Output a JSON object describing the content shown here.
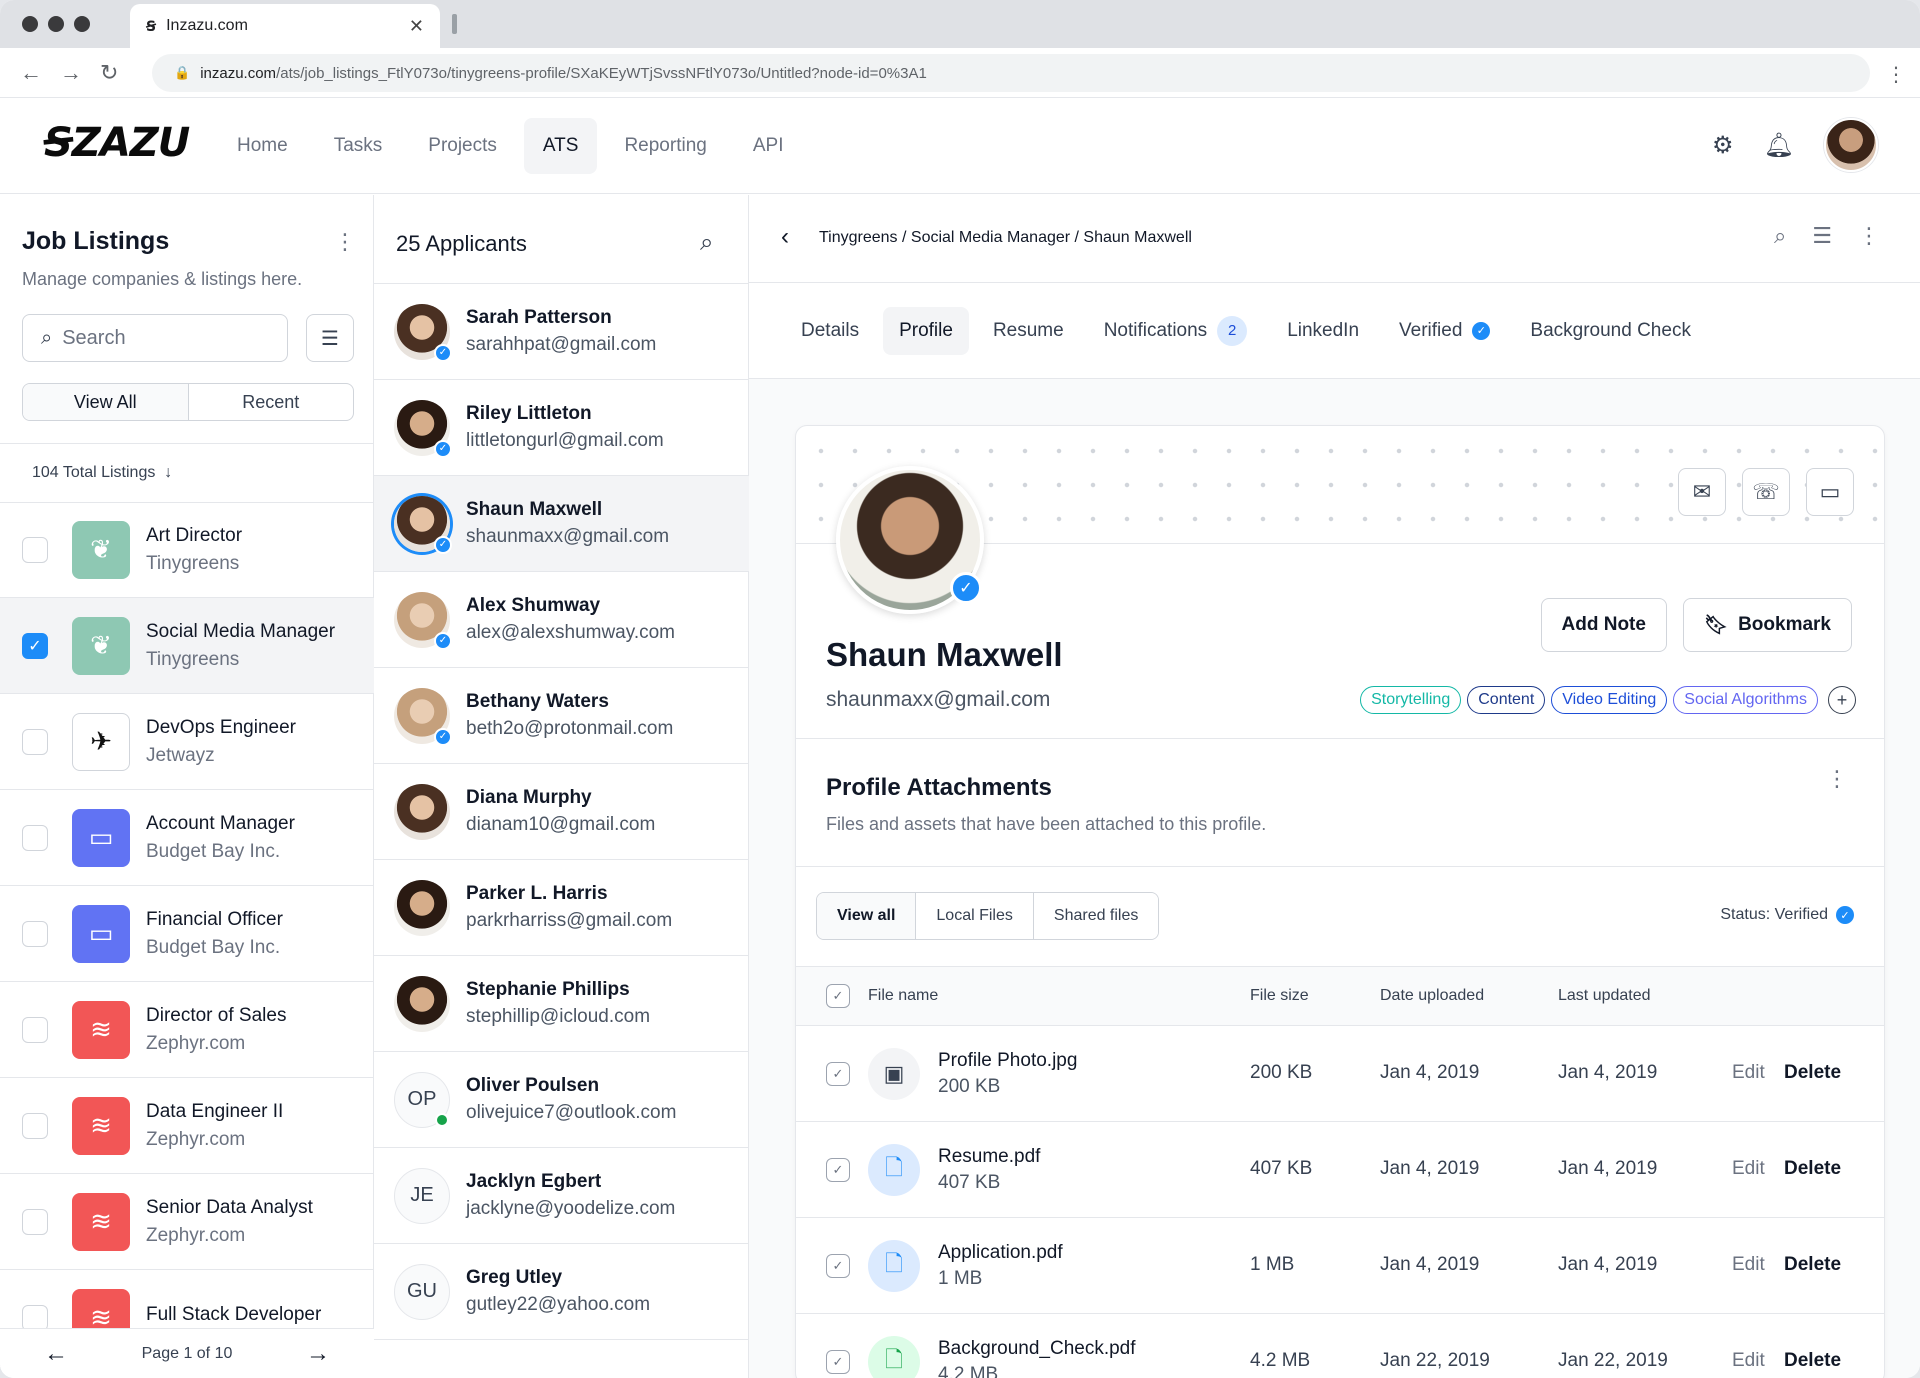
{
  "browser": {
    "tab_title": "Inzazu.com",
    "url_host": "inzazu.com",
    "url_path": "/ats/job_listings_FtlY073o/tinygreens-profile/SXaKEyWTjSvssNFtlY073o/Untitled?node-id=0%3A1"
  },
  "app": {
    "logo": "ꞨZAZU",
    "nav": [
      "Home",
      "Tasks",
      "Projects",
      "ATS",
      "Reporting",
      "API"
    ],
    "active_nav": "ATS"
  },
  "listings": {
    "title": "Job Listings",
    "subtitle": "Manage companies & listings here.",
    "search_placeholder": "Search",
    "view_all": "View All",
    "recent": "Recent",
    "total": "104 Total Listings",
    "items": [
      {
        "title": "Art Director",
        "company": "Tinygreens",
        "logo": "leaf-icon"
      },
      {
        "title": "Social Media Manager",
        "company": "Tinygreens",
        "logo": "leaf-icon",
        "selected": true
      },
      {
        "title": "DevOps Engineer",
        "company": "Jetwayz",
        "logo": "plane-icon"
      },
      {
        "title": "Account Manager",
        "company": "Budget Bay Inc.",
        "logo": "card-icon"
      },
      {
        "title": "Financial Officer",
        "company": "Budget Bay Inc.",
        "logo": "card-icon"
      },
      {
        "title": "Director of Sales",
        "company": "Zephyr.com",
        "logo": "wind-icon"
      },
      {
        "title": "Data Engineer II",
        "company": "Zephyr.com",
        "logo": "wind-icon"
      },
      {
        "title": "Senior Data Analyst",
        "company": "Zephyr.com",
        "logo": "wind-icon"
      },
      {
        "title": "Full Stack Developer",
        "company": "",
        "logo": "wind-icon"
      }
    ],
    "pager": "Page 1 of 10"
  },
  "applicants": {
    "title": "25 Applicants",
    "items": [
      {
        "name": "Sarah Patterson",
        "email": "sarahhpat@gmail.com"
      },
      {
        "name": "Riley Littleton",
        "email": "littletongurl@gmail.com"
      },
      {
        "name": "Shaun Maxwell",
        "email": "shaunmaxx@gmail.com"
      },
      {
        "name": "Alex Shumway",
        "email": "alex@alexshumway.com"
      },
      {
        "name": "Bethany Waters",
        "email": "beth2o@protonmail.com"
      },
      {
        "name": "Diana Murphy",
        "email": "dianam10@gmail.com"
      },
      {
        "name": "Parker L. Harris",
        "email": "parkrharriss@gmail.com"
      },
      {
        "name": "Stephanie Phillips",
        "email": "stephillip@icloud.com"
      },
      {
        "name": "Oliver Poulsen",
        "email": "olivejuice7@outlook.com",
        "initials": "OP"
      },
      {
        "name": "Jacklyn Egbert",
        "email": "jacklyne@yoodelize.com",
        "initials": "JE"
      },
      {
        "name": "Greg Utley",
        "email": "gutley22@yahoo.com",
        "initials": "GU"
      }
    ]
  },
  "profile": {
    "breadcrumb": "Tinygreens / Social Media Manager / Shaun Maxwell",
    "tabs": [
      "Details",
      "Profile",
      "Resume",
      "Notifications",
      "LinkedIn",
      "Verified",
      "Background Check"
    ],
    "notifications_count": "2",
    "name": "Shaun Maxwell",
    "email": "shaunmaxx@gmail.com",
    "add_note": "Add Note",
    "bookmark": "Bookmark",
    "tags": [
      "Storytelling",
      "Content",
      "Video Editing",
      "Social Algorithms"
    ],
    "attachments_title": "Profile Attachments",
    "attachments_sub": "Files and assets that have been attached to this profile.",
    "filters": [
      "View all",
      "Local Files",
      "Shared files"
    ],
    "status": "Status: Verified",
    "columns": {
      "name": "File name",
      "size": "File size",
      "uploaded": "Date uploaded",
      "updated": "Last updated"
    },
    "edit": "Edit",
    "delete": "Delete",
    "files": [
      {
        "name": "Profile Photo.jpg",
        "size": "200 KB",
        "uploaded": "Jan 4, 2019",
        "updated": "Jan 4, 2019"
      },
      {
        "name": "Resume.pdf",
        "size": "407 KB",
        "uploaded": "Jan 4, 2019",
        "updated": "Jan 4, 2019"
      },
      {
        "name": "Application.pdf",
        "size": "1 MB",
        "uploaded": "Jan 4, 2019",
        "updated": "Jan 4, 2019"
      },
      {
        "name": "Background_Check.pdf",
        "size": "4.2 MB",
        "uploaded": "Jan 22, 2019",
        "updated": "Jan 22, 2019"
      }
    ]
  }
}
